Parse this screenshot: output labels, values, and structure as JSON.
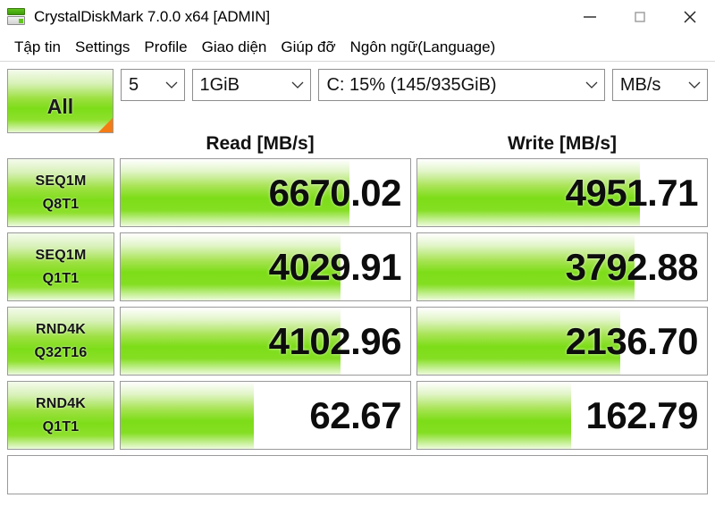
{
  "window": {
    "title": "CrystalDiskMark 7.0.0 x64 [ADMIN]",
    "icon": "disk-icon",
    "controls": {
      "minimize": "minimize-icon",
      "maximize": "maximize-icon",
      "close": "close-icon"
    }
  },
  "menubar": {
    "items": [
      {
        "label": "Tập tin"
      },
      {
        "label": "Settings"
      },
      {
        "label": "Profile"
      },
      {
        "label": "Giao diện"
      },
      {
        "label": "Giúp đỡ"
      },
      {
        "label": "Ngôn ngữ(Language)"
      }
    ]
  },
  "toolbar": {
    "all_button_label": "All",
    "test_count": "5",
    "test_size": "1GiB",
    "target_drive": "C: 15% (145/935GiB)",
    "unit": "MB/s"
  },
  "columns": {
    "read_header": "Read [MB/s]",
    "write_header": "Write [MB/s]"
  },
  "status": {
    "text": ""
  },
  "colors": {
    "bar_green": "#7ddd18",
    "bar_green_light": "#a9e457",
    "accent_orange": "#f57c14",
    "border_gray": "#9a9a9a"
  },
  "chart_data": {
    "type": "bar",
    "title": "CrystalDiskMark 7.0.0 x64 [ADMIN]",
    "xlabel": "",
    "ylabel": "MB/s",
    "unit": "MB/s",
    "test_count": 5,
    "test_size": "1GiB",
    "target": "C: 15% (145/935GiB)",
    "categories": [
      "SEQ1M Q8T1",
      "SEQ1M Q1T1",
      "RND4K Q32T16",
      "RND4K Q1T1"
    ],
    "series": [
      {
        "name": "Read [MB/s]",
        "values": [
          6670.02,
          4029.91,
          4102.96,
          62.67
        ]
      },
      {
        "name": "Write [MB/s]",
        "values": [
          4951.71,
          3792.88,
          2136.7,
          162.79
        ]
      }
    ],
    "rows": [
      {
        "label_main": "SEQ1M",
        "label_sub": "Q8T1",
        "read": {
          "value": "6670.02",
          "fill_pct": 79
        },
        "write": {
          "value": "4951.71",
          "fill_pct": 77
        }
      },
      {
        "label_main": "SEQ1M",
        "label_sub": "Q1T1",
        "read": {
          "value": "4029.91",
          "fill_pct": 76
        },
        "write": {
          "value": "3792.88",
          "fill_pct": 75
        }
      },
      {
        "label_main": "RND4K",
        "label_sub": "Q32T16",
        "read": {
          "value": "4102.96",
          "fill_pct": 76
        },
        "write": {
          "value": "2136.70",
          "fill_pct": 70
        }
      },
      {
        "label_main": "RND4K",
        "label_sub": "Q1T1",
        "read": {
          "value": "62.67",
          "fill_pct": 46
        },
        "write": {
          "value": "162.79",
          "fill_pct": 53
        }
      }
    ]
  }
}
